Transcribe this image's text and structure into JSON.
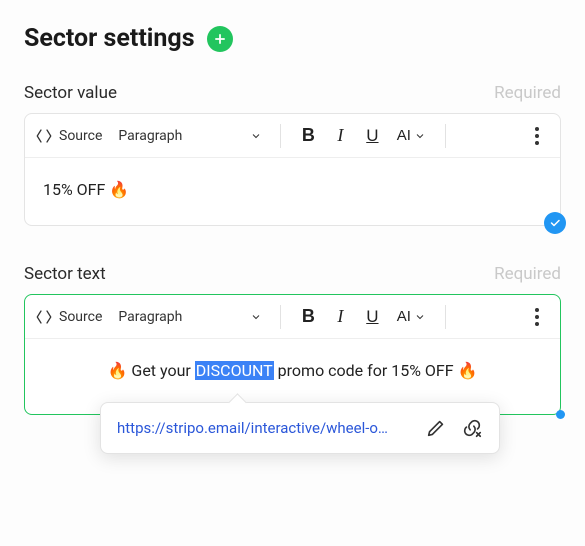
{
  "header": {
    "title": "Sector settings"
  },
  "labels": {
    "required": "Required"
  },
  "toolbar": {
    "source": "Source",
    "paragraph": "Paragraph",
    "bold": "B",
    "italic": "I",
    "underline": "U",
    "ai": "AI"
  },
  "sector_value": {
    "label": "Sector value",
    "content": "15% OFF 🔥"
  },
  "sector_text": {
    "label": "Sector text",
    "pre": "🔥 Get your ",
    "highlight": "DISCOUNT",
    "post": " promo code for 15% OFF 🔥"
  },
  "link_popover": {
    "url": "https://stripo.email/interactive/wheel-o…"
  }
}
